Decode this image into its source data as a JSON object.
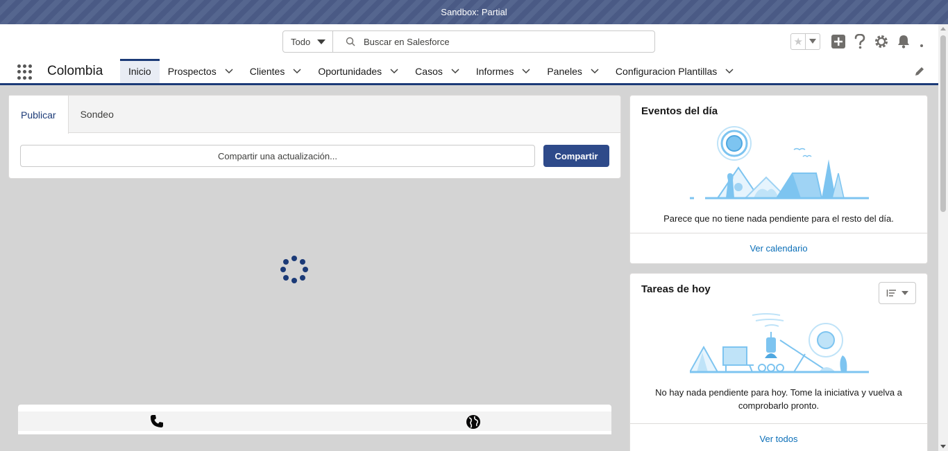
{
  "banner": {
    "text": "Sandbox: Partial"
  },
  "search": {
    "scope": "Todo",
    "placeholder": "Buscar en Salesforce"
  },
  "nav": {
    "app_name": "Colombia",
    "items": [
      {
        "label": "Inicio",
        "active": true
      },
      {
        "label": "Prospectos"
      },
      {
        "label": "Clientes"
      },
      {
        "label": "Oportunidades"
      },
      {
        "label": "Casos"
      },
      {
        "label": "Informes"
      },
      {
        "label": "Paneles"
      },
      {
        "label": "Configuracion Plantillas"
      }
    ]
  },
  "publisher": {
    "tabs": [
      "Publicar",
      "Sondeo"
    ],
    "input_placeholder": "Compartir una actualización...",
    "share_label": "Compartir"
  },
  "events": {
    "title": "Eventos del día",
    "message": "Parece que no tiene nada pendiente para el resto del día.",
    "link": "Ver calendario"
  },
  "tasks": {
    "title": "Tareas de hoy",
    "message_line1": "No hay nada pendiente para hoy. Tome la iniciativa y vuelva a",
    "message_line2": "comprobarlo pronto.",
    "link": "Ver todos"
  },
  "colors": {
    "brand": "#1b3a77",
    "button": "#2e4a8a",
    "link": "#0b6fb8",
    "illustration": "#7dc4f0"
  },
  "icons": [
    "search-icon",
    "star-icon",
    "add-icon",
    "help-icon",
    "gear-icon",
    "bell-icon",
    "app-launcher-icon",
    "edit-icon",
    "phone-icon",
    "globe-icon",
    "sort-icon"
  ]
}
